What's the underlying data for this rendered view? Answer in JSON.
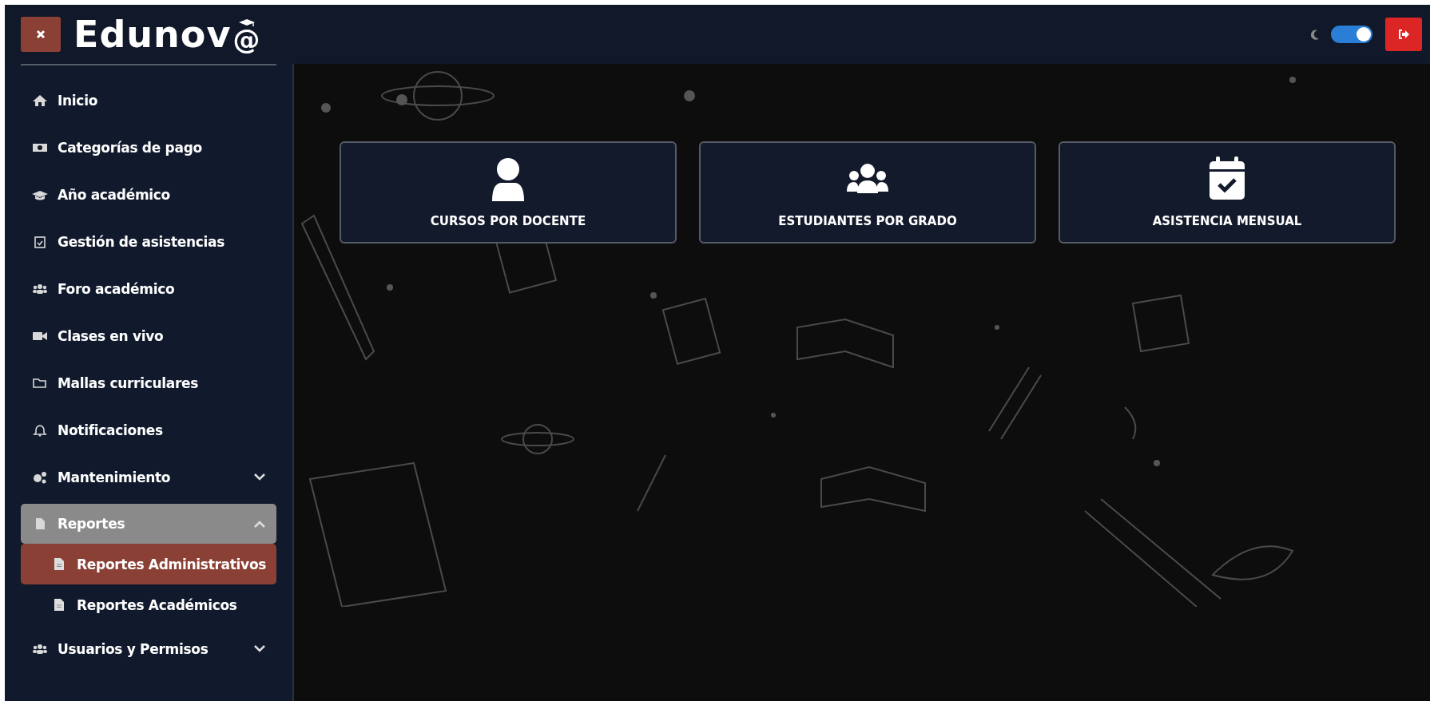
{
  "logo": {
    "text": "Edunov",
    "mark": "@"
  },
  "header": {
    "theme_toggle": {
      "on": true
    }
  },
  "sidebar": {
    "items": [
      {
        "kind": "link",
        "label": "Inicio",
        "selected": false
      },
      {
        "kind": "link",
        "label": "Categorías de pago",
        "selected": false
      },
      {
        "kind": "link",
        "label": "Año académico",
        "selected": false
      },
      {
        "kind": "link",
        "label": "Gestión de asistencias",
        "selected": false
      },
      {
        "kind": "link",
        "label": "Foro académico",
        "selected": false
      },
      {
        "kind": "link",
        "label": "Clases en vivo",
        "selected": false
      },
      {
        "kind": "link",
        "label": "Mallas curriculares",
        "selected": false
      },
      {
        "kind": "link",
        "label": "Notificaciones",
        "selected": false
      },
      {
        "kind": "group",
        "label": "Mantenimiento",
        "selected": false,
        "expanded": false
      },
      {
        "kind": "group",
        "label": "Reportes",
        "selected": false,
        "expanded": true,
        "children": [
          {
            "label": "Reportes Administrativos",
            "selected": true
          },
          {
            "label": "Reportes Académicos",
            "selected": false
          }
        ]
      },
      {
        "kind": "group",
        "label": "Usuarios y Permisos",
        "selected": false,
        "expanded": false
      }
    ]
  },
  "cards": [
    {
      "title": "CURSOS POR DOCENTE"
    },
    {
      "title": "ESTUDIANTES POR GRADO"
    },
    {
      "title": "ASISTENCIA MENSUAL"
    }
  ]
}
